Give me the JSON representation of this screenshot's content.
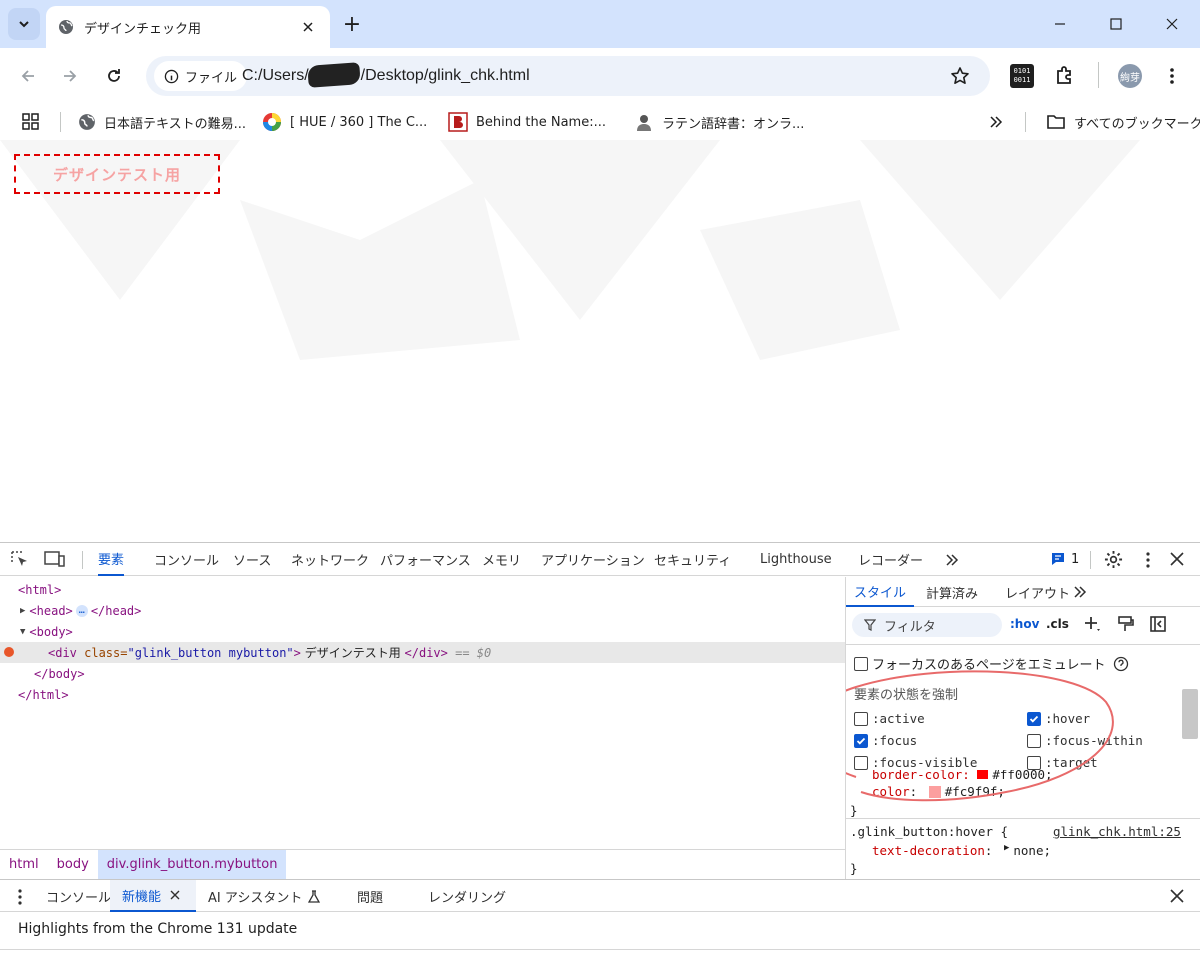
{
  "browser": {
    "tab_title": "デザインチェック用",
    "url_chip": "ファイル",
    "url_prefix": "C:/Users/",
    "url_suffix": "/Desktop/glink_chk.html",
    "profile_label": "絢芽",
    "bookmarks": [
      {
        "label": "日本語テキストの難易...",
        "icon": "globe-icon"
      },
      {
        "label": "[ HUE / 360 ] The C...",
        "icon": "color-wheel-icon"
      },
      {
        "label": "Behind the Name:...",
        "icon": "b-logo-icon"
      },
      {
        "label": "ラテン語辞書：オンラ...",
        "icon": "person-icon"
      }
    ],
    "all_bookmarks": "すべてのブックマーク"
  },
  "page": {
    "button_text": "デザインテスト用"
  },
  "devtools": {
    "tabs": [
      "要素",
      "コンソール",
      "ソース",
      "ネットワーク",
      "パフォーマンス",
      "メモリ",
      "アプリケーション",
      "セキュリティ",
      "Lighthouse",
      "レコーダー"
    ],
    "issues_count": "1",
    "dom": {
      "html_open": "<html>",
      "head": "<head>",
      "head_close": "</head>",
      "body_open": "<body>",
      "div_open_tag": "<div ",
      "div_attr_name": "class=",
      "div_attr_value": "\"glink_button mybutton\"",
      "div_gt": ">",
      "div_text": " デザインテスト用 ",
      "div_close": "</div>",
      "selected_marker": " == $0",
      "body_close": "</body>",
      "html_close": "</html>"
    },
    "breadcrumbs": [
      "html",
      "body",
      "div.glink_button.mybutton"
    ],
    "styles_tabs": [
      "スタイル",
      "計算済み",
      "レイアウト"
    ],
    "filter_placeholder": "フィルタ",
    "hov": ":hov",
    "cls": ".cls",
    "emulate_focus": "フォーカスのあるページをエミュレート",
    "force_state_heading": "要素の状態を強制",
    "states": [
      {
        "label": ":active",
        "checked": false
      },
      {
        "label": ":hover",
        "checked": true
      },
      {
        "label": ":focus",
        "checked": true
      },
      {
        "label": ":focus-within",
        "checked": false
      },
      {
        "label": ":focus-visible",
        "checked": false
      },
      {
        "label": ":target",
        "checked": false
      }
    ],
    "css_partial_prop": "border-color: ",
    "css_partial_val": "#ff0000;",
    "css_color_prop": "color",
    "css_color_val": "#fc9f9f;",
    "css_color_swatch": "#fc9f9f",
    "css_close": "}",
    "hover_selector": ".glink_button:hover {",
    "hover_source": "glink_chk.html:25",
    "hover_prop": "text-decoration",
    "hover_val": "none;",
    "hover_close": "}",
    "drawer_tabs": [
      "コンソール",
      "新機能",
      "AI アシスタント",
      "問題",
      "レンダリング"
    ],
    "drawer_text": "Highlights from the Chrome 131 update"
  }
}
